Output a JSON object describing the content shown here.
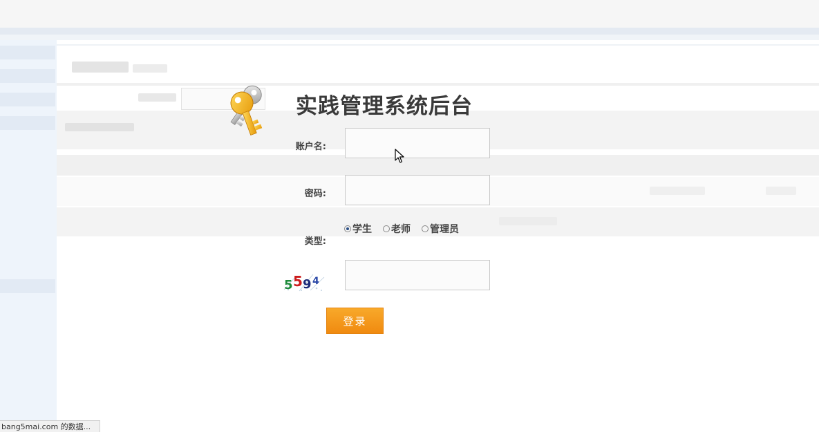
{
  "login": {
    "title": "实践管理系统后台",
    "username_label": "账户名:",
    "username_value": "",
    "password_label": "密码:",
    "password_value": "",
    "type_label": "类型:",
    "type_options": [
      "学生",
      "老师",
      "管理员"
    ],
    "type_selected": "学生",
    "captcha_code": "5594",
    "captcha_value": "",
    "submit_label": "登录"
  },
  "status_bar": {
    "text": "bang5mai.com 的数据..."
  },
  "colors": {
    "button_orange": "#f39a18",
    "title_gray": "#3a3a3a",
    "key_gold": "#f2b21c",
    "key_silver": "#b9b9b9"
  },
  "icons": {
    "key": "key-icon",
    "cursor": "mouse-cursor-icon"
  }
}
